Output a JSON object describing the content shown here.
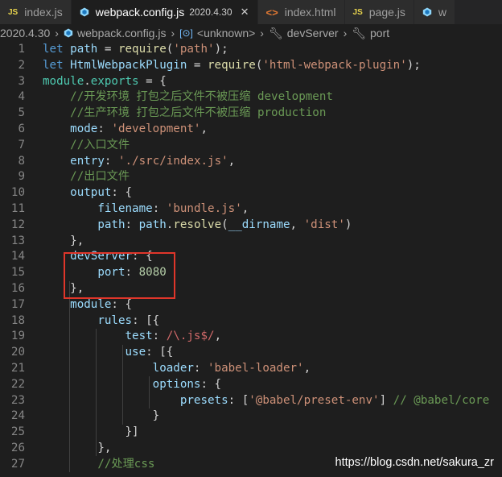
{
  "tabs": [
    {
      "icon": "js-file-icon",
      "label": "index.js",
      "active": false
    },
    {
      "icon": "webpack-icon",
      "label": "webpack.config.js",
      "desc": "2020.4.30",
      "close": "✕",
      "active": true
    },
    {
      "icon": "html-file-icon",
      "label": "index.html",
      "active": false
    },
    {
      "icon": "js-file-icon",
      "label": "page.js",
      "active": false
    },
    {
      "icon": "webpack-icon",
      "label": "w",
      "active": false
    }
  ],
  "breadcrumb": {
    "folder": "2020.4.30",
    "file": "webpack.config.js",
    "symbol1": "<unknown>",
    "symbol2": "devServer",
    "symbol3": "port"
  },
  "code_lines": [
    {
      "n": "1",
      "html": "<span class=\"k\">let</span> <span class=\"v\">path</span> = <span class=\"f\">require</span>(<span class=\"s\">'path'</span>);"
    },
    {
      "n": "2",
      "html": "<span class=\"k\">let</span> <span class=\"v\">HtmlWebpackPlugin</span> = <span class=\"f\">require</span>(<span class=\"s\">'html-webpack-plugin'</span>);"
    },
    {
      "n": "3",
      "html": "<span class=\"cl\">module</span>.<span class=\"cl\">exports</span> = {"
    },
    {
      "n": "4",
      "html": "    <span class=\"c\">//开发环境 打包之后文件不被压缩 development</span>"
    },
    {
      "n": "5",
      "html": "    <span class=\"c\">//生产环境 打包之后文件不被压缩 production</span>"
    },
    {
      "n": "6",
      "html": "    <span class=\"v\">mode</span>: <span class=\"s\">'development'</span>,"
    },
    {
      "n": "7",
      "html": "    <span class=\"c\">//入口文件</span>"
    },
    {
      "n": "8",
      "html": "    <span class=\"v\">entry</span>: <span class=\"s\">'./src/index.js'</span>,"
    },
    {
      "n": "9",
      "html": "    <span class=\"c\">//出口文件</span>"
    },
    {
      "n": "10",
      "html": "    <span class=\"v\">output</span>: {"
    },
    {
      "n": "11",
      "html": "        <span class=\"v\">filename</span>: <span class=\"s\">'bundle.js'</span>,"
    },
    {
      "n": "12",
      "html": "        <span class=\"v\">path</span>: <span class=\"v\">path</span>.<span class=\"f\">resolve</span>(<span class=\"v\">__dirname</span>, <span class=\"s\">'dist'</span>)"
    },
    {
      "n": "13",
      "html": "    },"
    },
    {
      "n": "14",
      "html": "    <span class=\"v\">devServer</span>: {"
    },
    {
      "n": "15",
      "html": "        <span class=\"v\">port</span>: <span class=\"n\">8080</span>"
    },
    {
      "n": "16",
      "html": "    },"
    },
    {
      "n": "17",
      "html": "    <span class=\"v\">module</span>: {"
    },
    {
      "n": "18",
      "html": "        <span class=\"v\">rules</span>: [{"
    },
    {
      "n": "19",
      "html": "            <span class=\"v\">test</span>: <span class=\"r\">/\\.js$/</span>,"
    },
    {
      "n": "20",
      "html": "            <span class=\"v\">use</span>: [{"
    },
    {
      "n": "21",
      "html": "                <span class=\"v\">loader</span>: <span class=\"s\">'babel-loader'</span>,"
    },
    {
      "n": "22",
      "html": "                <span class=\"v\">options</span>: {"
    },
    {
      "n": "23",
      "html": "                    <span class=\"v\">presets</span>: [<span class=\"s\">'@babel/preset-env'</span>] <span class=\"c\">// @babel/core</span>"
    },
    {
      "n": "24",
      "html": "                }"
    },
    {
      "n": "25",
      "html": "            }]"
    },
    {
      "n": "26",
      "html": "        },"
    },
    {
      "n": "27",
      "html": "        <span class=\"c\">//处理css</span>"
    }
  ],
  "watermark": "https://blog.csdn.net/sakura_zr"
}
